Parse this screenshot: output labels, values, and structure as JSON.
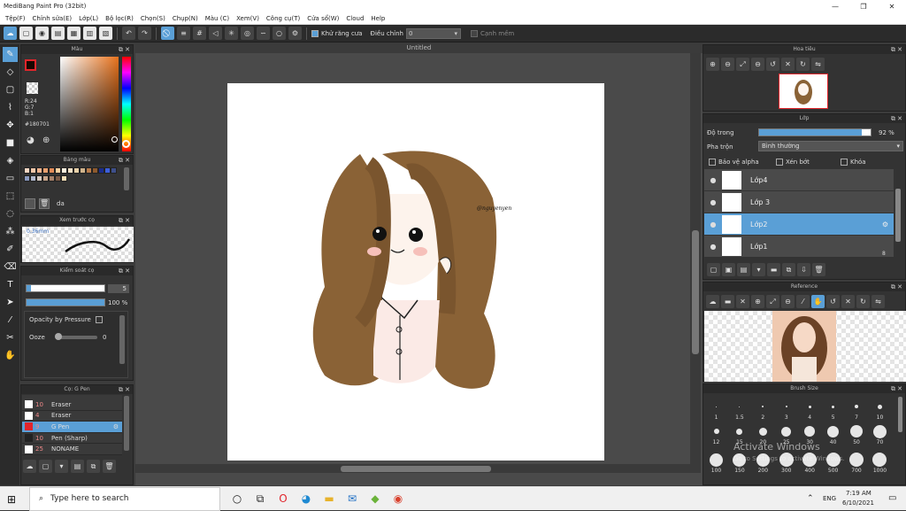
{
  "title": "MediBang Paint Pro (32bit)",
  "menu": [
    "Tệp(F)",
    "Chỉnh sửa(E)",
    "Lớp(L)",
    "Bộ lọc(R)",
    "Chọn(S)",
    "Chụp(N)",
    "Màu (C)",
    "Xem(V)",
    "Công cụ(T)",
    "Cửa sổ(W)",
    "Cloud",
    "Help"
  ],
  "toolbar": {
    "antialias_label": "Khử răng cưa",
    "adjust_label": "Điều chỉnh",
    "adjust_value": "0",
    "canh_mem_label": "Cạnh mềm"
  },
  "color_panel": {
    "title": "Màu",
    "r": "R:24",
    "g": "G:7",
    "b": "B:1",
    "hex": "#180701"
  },
  "swatch_panel": {
    "title": "Bảng màu",
    "name": "da",
    "colors": [
      "#f7d7c4",
      "#f2c7a9",
      "#f0b38e",
      "#e9a06f",
      "#e38b58",
      "#ffd1a1",
      "#fff2df",
      "#f4e1c6",
      "#e8d0a8",
      "#cfb38c",
      "#b77b4a",
      "#8e5a2e",
      "#1a2c8c",
      "#3d5fd9",
      "#3e4f8a",
      "#8a9ac0",
      "#b0b7cc",
      "#d6c9c0",
      "#c7a48b",
      "#a8826a",
      "#7a5a48",
      "#f7e0b8"
    ]
  },
  "brush_preview": {
    "title": "Xem trước cọ",
    "size": "0.36mm"
  },
  "brush_control": {
    "title": "Kiểm soát cọ",
    "size_value": "5",
    "opacity_value": "100 %",
    "opacity_pressure": "Opacity by Pressure",
    "ooze_label": "Ooze",
    "ooze_value": "0"
  },
  "brush_list": {
    "title": "Cọ: G Pen",
    "items": [
      {
        "num": "10",
        "name": "Eraser",
        "color": "#ffffff"
      },
      {
        "num": "4",
        "name": "Eraser",
        "color": "#ffffff"
      },
      {
        "num": "9",
        "name": "G Pen",
        "color": "#e2252b",
        "selected": true
      },
      {
        "num": "10",
        "name": "Pen (Sharp)",
        "color": "#222222"
      },
      {
        "num": "25",
        "name": "NONAME",
        "color": "#ffffff"
      }
    ]
  },
  "doc_title": "Untitled",
  "watermark_signature": "@nguyenyen",
  "navigator": {
    "title": "Hoa tiêu"
  },
  "layer_panel": {
    "title": "Lớp",
    "opacity_label": "Độ trong",
    "opacity_value": "92 %",
    "opacity_fraction": 0.92,
    "blend_label": "Pha trộn",
    "blend_value": "Bình thường",
    "protect_alpha": "Bảo vệ alpha",
    "clipping": "Xén bớt",
    "lock": "Khóa",
    "layers": [
      {
        "name": "Lớp4",
        "selected": false
      },
      {
        "name": "Lớp 3",
        "selected": false
      },
      {
        "name": "Lớp2",
        "selected": true
      },
      {
        "name": "Lớp1",
        "selected": false
      }
    ],
    "layer1_badge": "8"
  },
  "reference": {
    "title": "Reference"
  },
  "brush_size": {
    "title": "Brush Size",
    "row1": [
      "1",
      "1.5",
      "2",
      "3",
      "4",
      "5",
      "7",
      "10"
    ],
    "row2": [
      "12",
      "15",
      "20",
      "25",
      "30",
      "40",
      "50",
      "70"
    ],
    "row3": [
      "100",
      "150",
      "200",
      "300",
      "400",
      "500",
      "700",
      "1000"
    ]
  },
  "activation": {
    "line1": "Activate Windows",
    "line2": "Go to Settings to activate Windows."
  },
  "taskbar": {
    "search": "Type here to search",
    "lang": "ENG",
    "time": "7:19 AM",
    "date": "6/10/2021"
  }
}
